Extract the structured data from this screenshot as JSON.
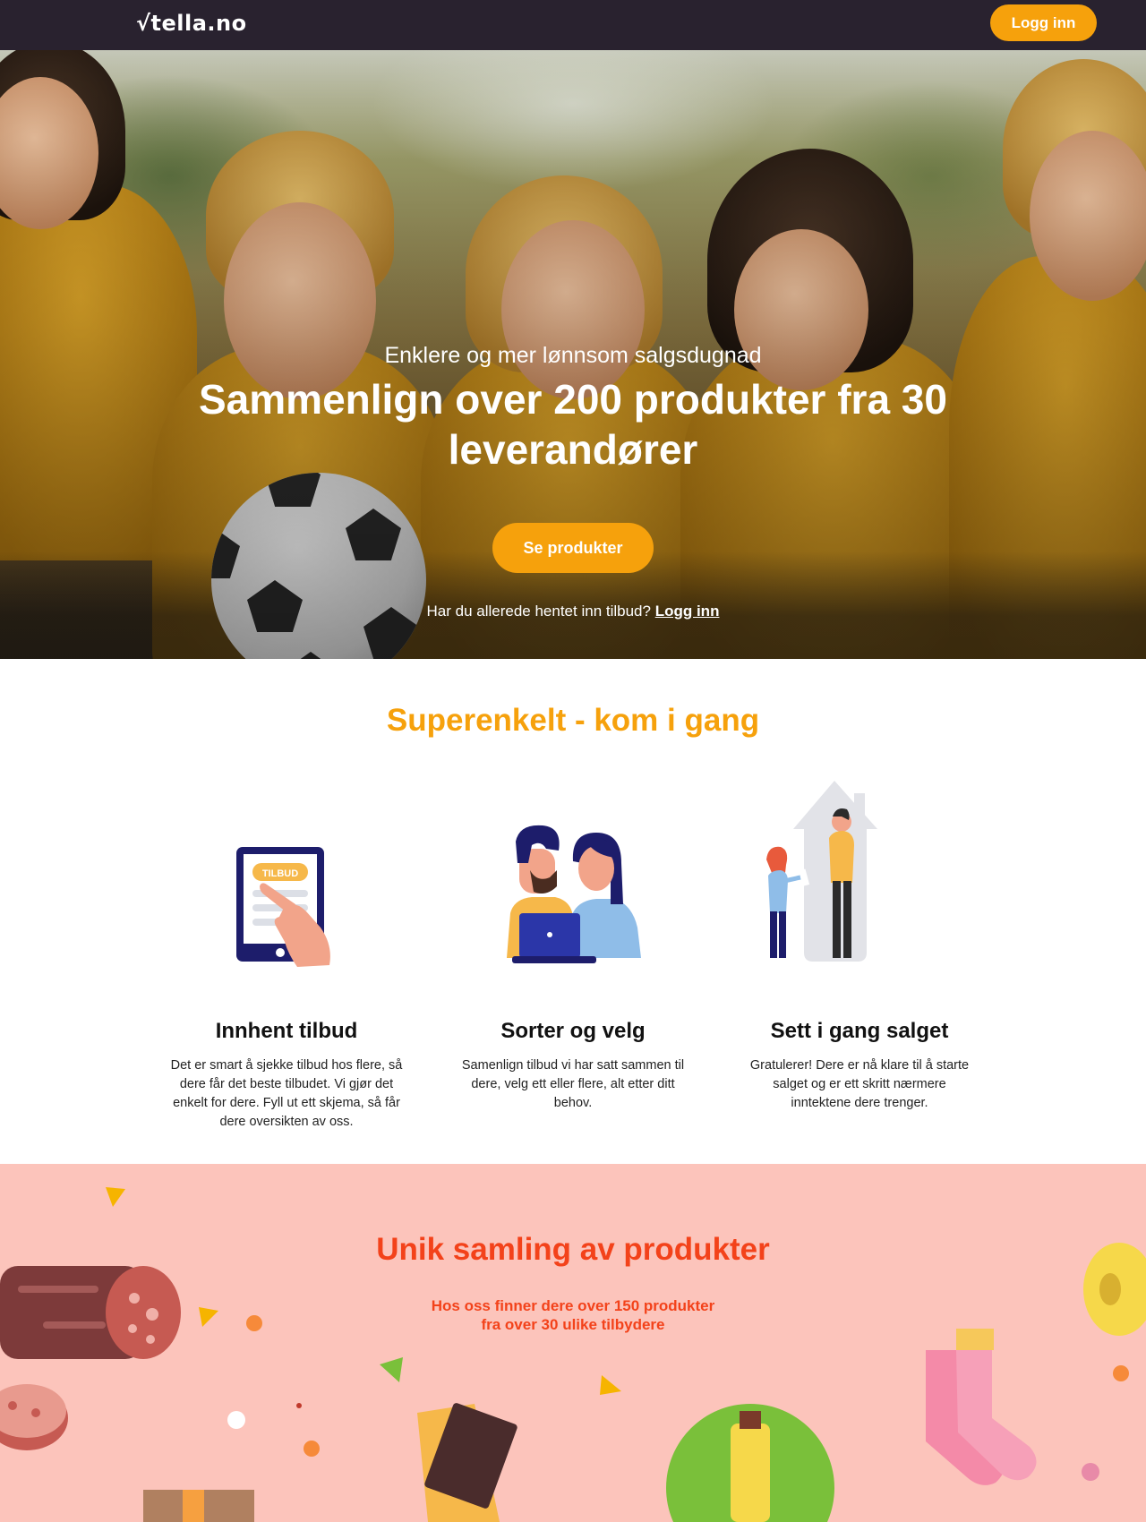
{
  "header": {
    "logo": "√tella.no",
    "login_label": "Logg inn"
  },
  "hero": {
    "subtitle": "Enklere og mer lønnsom salgsdugnad",
    "title": "Sammenlign over 200 produkter fra 30 leverandører",
    "cta_label": "Se produkter",
    "login_prompt": "Har du allerede hentet inn tilbud?",
    "login_link": "Logg inn"
  },
  "steps": {
    "title": "Superenkelt - kom i gang",
    "items": [
      {
        "illustration_badge": "TILBUD",
        "heading": "Innhent tilbud",
        "text": "Det er smart å sjekke tilbud hos flere, så dere får det beste tilbudet. Vi gjør det enkelt for dere. Fyll ut ett skjema, så får dere oversikten av oss."
      },
      {
        "heading": "Sorter og velg",
        "text": "Samenlign tilbud vi har satt sammen til dere, velg ett eller flere, alt etter ditt behov."
      },
      {
        "heading": "Sett i gang salget",
        "text": "Gratulerer! Dere er nå klare til å starte salget og er ett skritt nærmere inntektene dere trenger."
      }
    ]
  },
  "products": {
    "title": "Unik samling av produkter",
    "subtitle_line1": "Hos oss finner dere over 150 produkter",
    "subtitle_line2": "fra over 30 ulike tilbydere"
  },
  "colors": {
    "header_bg": "#29222f",
    "accent_orange": "#f6a10c",
    "products_bg": "#fcc4bb",
    "products_red": "#f3421a"
  }
}
